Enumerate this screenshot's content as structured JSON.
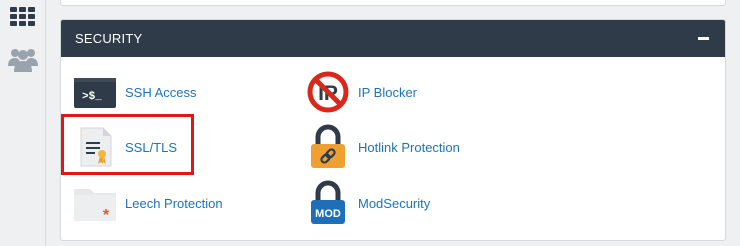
{
  "sidebar": {
    "items": [
      {
        "icon": "apps-grid-icon"
      },
      {
        "icon": "users-group-icon"
      }
    ]
  },
  "panel": {
    "title": "SECURITY",
    "collapse_icon": "minus-icon",
    "items": [
      {
        "label": "SSH Access",
        "icon": "terminal-icon",
        "terminal_text": ">$_"
      },
      {
        "label": "IP Blocker",
        "icon": "ip-blocker-icon",
        "icon_text": "IP"
      },
      {
        "label": "SSL/TLS",
        "icon": "certificate-icon"
      },
      {
        "label": "Hotlink Protection",
        "icon": "padlock-link-icon"
      },
      {
        "label": "Leech Protection",
        "icon": "folder-asterisk-icon"
      },
      {
        "label": "ModSecurity",
        "icon": "padlock-mod-icon",
        "icon_text": "MOD"
      }
    ]
  },
  "colors": {
    "header_bg": "#2f3b49",
    "link": "#1f73b7",
    "highlight": "#e11616",
    "lock_orange": "#f0a030",
    "lock_blue": "#1d6fb8",
    "blocker_red": "#d9281b"
  }
}
